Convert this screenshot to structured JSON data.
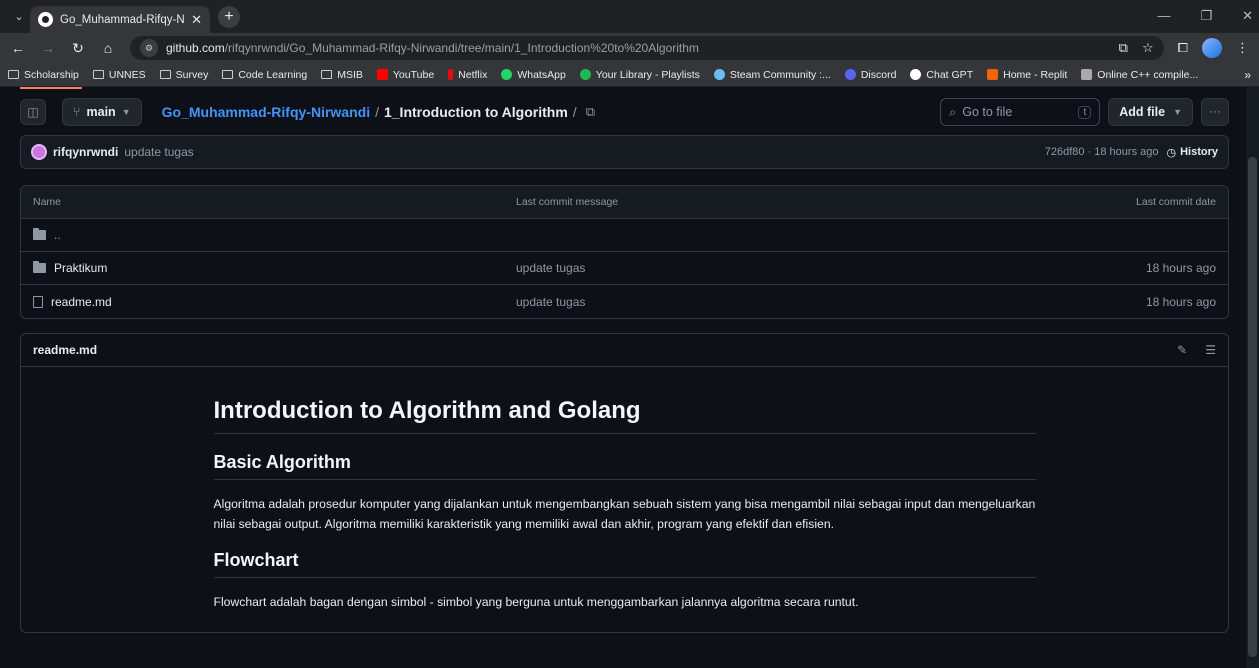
{
  "browser": {
    "tab_title": "Go_Muhammad-Rifqy-Nirwand",
    "url_host": "github.com",
    "url_path": "/rifqynrwndi/Go_Muhammad-Rifqy-Nirwandi/tree/main/1_Introduction%20to%20Algorithm"
  },
  "bookmarks": [
    "Scholarship",
    "UNNES",
    "Survey",
    "Code Learning",
    "MSIB",
    "YouTube",
    "Netflix",
    "WhatsApp",
    "Your Library - Playlists",
    "Steam Community :...",
    "Discord",
    "Chat GPT",
    "Home - Replit",
    "Online C++ compile..."
  ],
  "bookmark_colors": {
    "YouTube": "#ff0000",
    "Netflix": "#e50914",
    "WhatsApp": "#25d366",
    "Your Library - Playlists": "#1db954",
    "Steam Community :...": "#66c0f4",
    "Discord": "#5865f2",
    "Chat GPT": "#ffffff",
    "Home - Replit": "#f26207",
    "Online C++ compile...": "#aaaaaa"
  },
  "repo": {
    "branch": "main",
    "repo_name": "Go_Muhammad-Rifqy-Nirwandi",
    "folder": "1_Introduction to Algorithm",
    "goto_placeholder": "Go to file",
    "goto_shortcut": "t",
    "add_file": "Add file"
  },
  "commit": {
    "author": "rifqynrwndi",
    "message": "update tugas",
    "meta": "726df80 · 18 hours ago",
    "history": "History"
  },
  "files": {
    "headers": {
      "name": "Name",
      "message": "Last commit message",
      "date": "Last commit date"
    },
    "parent": "..",
    "rows": [
      {
        "name": "Praktikum",
        "type": "folder",
        "message": "update tugas",
        "date": "18 hours ago"
      },
      {
        "name": "readme.md",
        "type": "file",
        "message": "update tugas",
        "date": "18 hours ago"
      }
    ]
  },
  "readme": {
    "filename": "readme.md",
    "h1": "Introduction to Algorithm and Golang",
    "h2_1": "Basic Algorithm",
    "p1": "Algoritma adalah prosedur komputer yang dijalankan untuk mengembangkan sebuah sistem yang bisa mengambil nilai sebagai input dan mengeluarkan nilai sebagai output. Algoritma memiliki karakteristik yang memiliki awal dan akhir, program yang efektif dan efisien.",
    "h2_2": "Flowchart",
    "p2": "Flowchart adalah bagan dengan simbol - simbol yang berguna untuk menggambarkan jalannya algoritma secara runtut."
  }
}
